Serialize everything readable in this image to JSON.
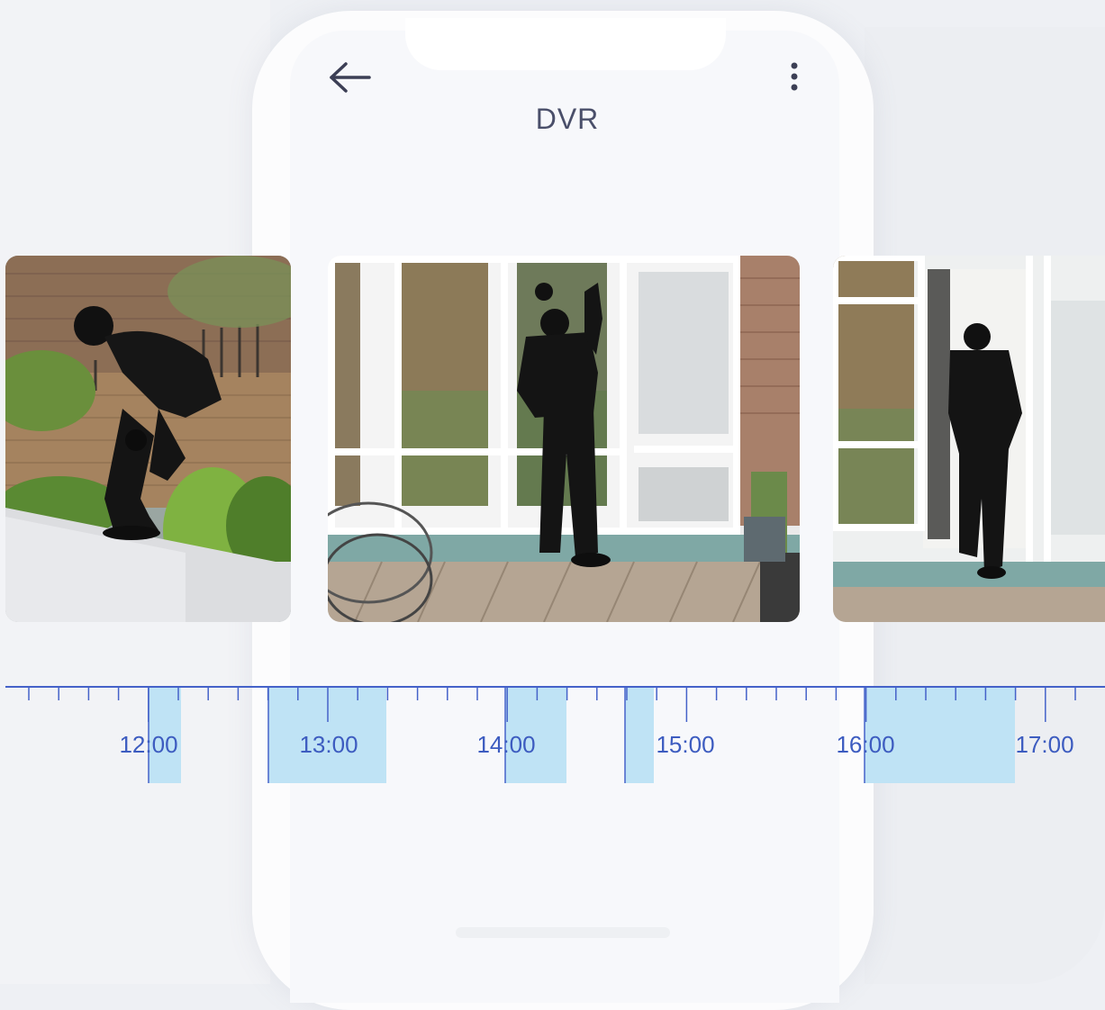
{
  "header": {
    "title": "DVR",
    "back_icon": "arrow-left-icon",
    "more_icon": "more-vertical-icon"
  },
  "thumbnails": [
    {
      "scene": "man in balaclava climbing over garden wall"
    },
    {
      "scene": "man in balaclava forcing patio glass door"
    },
    {
      "scene": "man in balaclava standing in open doorway"
    }
  ],
  "timeline": {
    "labels": [
      "12:00",
      "13:00",
      "14:00",
      "15:00",
      "16:00",
      "17:00"
    ],
    "accent_color": "#3d5cc0",
    "recording_color": "#bfe3f5"
  }
}
